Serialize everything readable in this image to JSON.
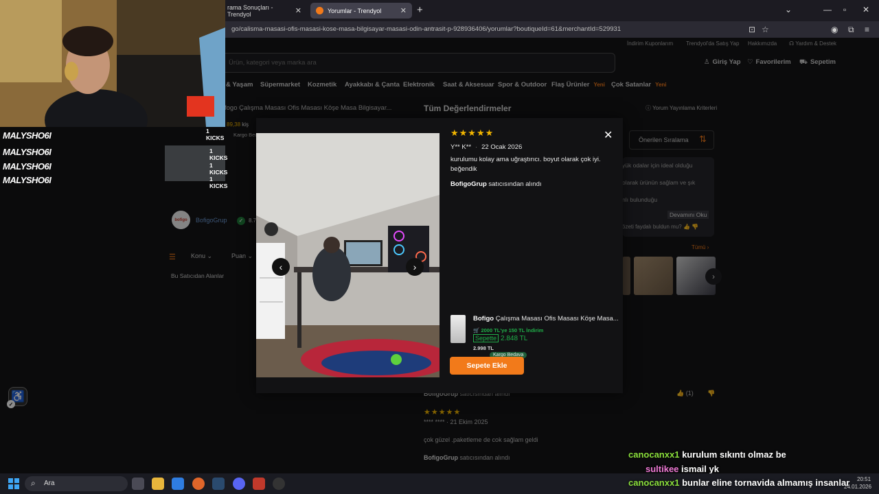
{
  "browser": {
    "tabs": [
      {
        "label": "rama Sonuçları - Trendyol"
      },
      {
        "label": "Yorumlar - Trendyol"
      }
    ],
    "url": "go/calisma-masasi-ofis-masasi-kose-masa-bilgisayar-masasi-odin-antrasit-p-928936406/yorumlar?boutiqueId=61&merchantId=529931"
  },
  "header": {
    "top_links": [
      "İndirim Kuponlarım",
      "Trendyol'da Satış Yap",
      "Hakkımızda",
      "Yardım & Destek"
    ],
    "search_placeholder": "Ürün, kategori veya marka ara",
    "login": "Giriş Yap",
    "favorites": "Favorilerim",
    "cart": "Sepetim",
    "categories": [
      {
        "label": "& Yaşam"
      },
      {
        "label": "Süpermarket"
      },
      {
        "label": "Kozmetik"
      },
      {
        "label": "Ayakkabı & Çanta"
      },
      {
        "label": "Elektronik"
      },
      {
        "label": "Saat & Aksesuar"
      },
      {
        "label": "Spor & Outdoor"
      },
      {
        "label": "Flaş Ürünler",
        "badge": "Yeni"
      },
      {
        "label": "Çok Satanlar",
        "badge": "Yeni"
      }
    ]
  },
  "page": {
    "breadcrumb_product": "fogo Çalışma Masası Ofis Masası Köşe Masa Bilgisayar...",
    "reviews_title": "Tüm Değerlendirmeler",
    "criteria_link": "Yorum Yayınlama Kriterleri",
    "sort_label": "Önerilen Sıralama",
    "summary_lines": [
      "yük odalar için ideal olduğu",
      "olarak ürünün sağlam ve şık",
      "nlı bulunduğu"
    ],
    "summary_more": "Devamını Oku",
    "summary_helpful": "özeti faydalı buldun mu?",
    "all_photos": "Tümü",
    "seller_name": "BofigoGrup",
    "seller_score": "8.7",
    "filters": [
      "Konu",
      "Puan"
    ],
    "seller_fields": "Bu Satıcıdan Alanlar",
    "mini_price": "89,38",
    "mini_unit": "kiş",
    "mini_kargo": "Kargo Bedava",
    "review_seller_line": {
      "seller": "BofigoGrup",
      "text": "satıcısından alındı"
    },
    "review_votes": "(1)",
    "review2": {
      "user": "**** ****",
      "date": "21 Ekim 2025",
      "text": "çok güzel .paketleme de cok sağlam geldi",
      "seller": "BofigoGrup",
      "seller_text": "satıcısından alındı"
    }
  },
  "modal": {
    "rating": 5,
    "stars": "★★★★★",
    "user": "Y** K**",
    "date": "22 Ocak 2026",
    "text": "kurulumu kolay ama uğraştırıcı. boyut olarak çok iyi. beğendik",
    "seller": "BofigoGrup",
    "seller_text": "satıcısından alındı",
    "product": {
      "brand": "Bofigo",
      "title": "Çalışma Masası Ofis Masası Köşe Masa...",
      "discount": "2000 TL'ye 150 TL İndirim",
      "sepette_label": "Sepette",
      "price": "2.848 TL",
      "old_price": "2.998 TL",
      "shipping": "Kargo Bedava",
      "add_to_cart": "Sepete Ekle"
    }
  },
  "stream": {
    "alerts": [
      {
        "name": "MALYSHO6I",
        "kicks": "1 KICKS"
      },
      {
        "name": "MALYSHO6I",
        "kicks": "1 KICKS"
      },
      {
        "name": "MALYSHO6I",
        "kicks": "1 KICKS"
      },
      {
        "name": "MALYSHO6I",
        "kicks": "1 KICKS"
      }
    ],
    "chat": [
      {
        "user": "canocanxx1",
        "message": "kurulum sıkıntı olmaz be"
      },
      {
        "user": "sultikee",
        "message": "ismail yk"
      },
      {
        "user": "canocanxx1",
        "message": "bunlar eline tornavida almamış insanlar"
      }
    ]
  },
  "taskbar": {
    "search": "Ara",
    "time": "20:51",
    "date": "24.01.2026"
  },
  "colors": {
    "accent": "#f27a1a",
    "star": "#f1b500",
    "green": "#20b04a",
    "link": "#6e9bd6"
  }
}
